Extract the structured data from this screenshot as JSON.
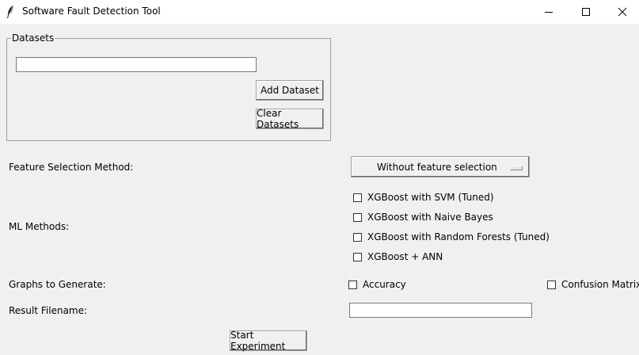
{
  "window": {
    "title": "Software Fault Detection Tool",
    "icon": "feather-icon",
    "controls": [
      "minimize-icon",
      "maximize-icon",
      "close-icon"
    ]
  },
  "datasets": {
    "legend": "Datasets",
    "input_value": "",
    "add_label": "Add Dataset",
    "clear_label": "Clear Datasets"
  },
  "feature_selection": {
    "label": "Feature Selection Method:",
    "selected": "Without feature selection"
  },
  "ml_methods": {
    "label": "ML Methods:",
    "options": [
      {
        "label": "XGBoost with SVM (Tuned)",
        "checked": false
      },
      {
        "label": "XGBoost with Naive Bayes",
        "checked": false
      },
      {
        "label": "XGBoost with Random Forests (Tuned)",
        "checked": false
      },
      {
        "label": "XGBoost + ANN",
        "checked": false
      }
    ]
  },
  "graphs": {
    "label": "Graphs to Generate:",
    "options": [
      {
        "label": "Accuracy",
        "checked": false
      },
      {
        "label": "Confusion Matrix",
        "checked": false
      }
    ]
  },
  "result": {
    "label": "Result Filename:",
    "value": ""
  },
  "start_label": "Start Experiment"
}
